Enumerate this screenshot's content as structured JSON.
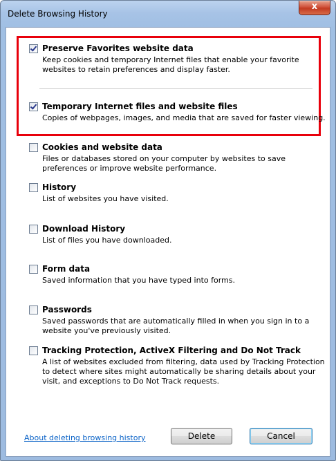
{
  "window": {
    "title": "Delete Browsing History",
    "close_glyph": "x"
  },
  "options": [
    {
      "title": "Preserve Favorites website data",
      "checked": true,
      "description": "Keep cookies and temporary Internet files that enable your favorite websites to retain preferences and display faster."
    },
    {
      "title": "Temporary Internet files and website files",
      "checked": true,
      "description": "Copies of webpages, images, and media that are saved for faster viewing."
    },
    {
      "title": "Cookies and website data",
      "checked": false,
      "description": "Files or databases stored on your computer by websites to save preferences or improve website performance."
    },
    {
      "title": "History",
      "checked": false,
      "description": "List of websites you have visited."
    },
    {
      "title": "Download History",
      "checked": false,
      "description": "List of files you have downloaded."
    },
    {
      "title": "Form data",
      "checked": false,
      "description": "Saved information that you have typed into forms."
    },
    {
      "title": "Passwords",
      "checked": false,
      "description": "Saved passwords that are automatically filled in when you sign in to a website you've previously visited."
    },
    {
      "title": "Tracking Protection, ActiveX Filtering and Do Not Track",
      "checked": false,
      "description": "A list of websites excluded from filtering, data used by Tracking Protection to detect where sites might automatically be sharing details about your visit, and exceptions to Do Not Track requests."
    }
  ],
  "footer": {
    "link": "About deleting browsing history",
    "delete_label": "Delete",
    "cancel_label": "Cancel"
  },
  "colors": {
    "highlight_border": "#e8000b",
    "link": "#0b63c7"
  }
}
